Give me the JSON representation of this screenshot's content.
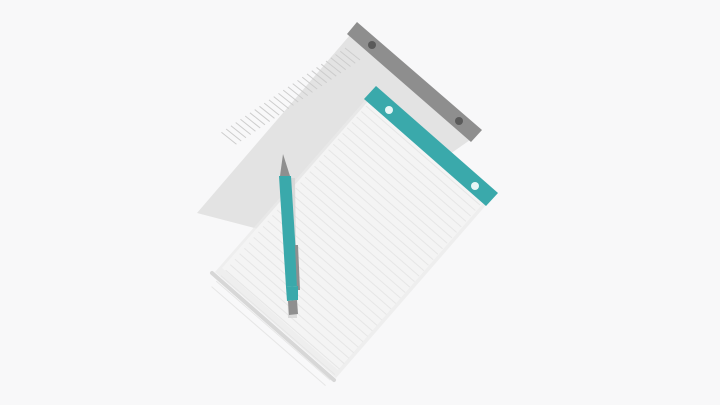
{
  "colors": {
    "background": "#f8f8f9",
    "back_pad_header": "#8e8e8e",
    "back_pad_paper": "#e3e3e3",
    "back_pad_lines": "#cdcdcd",
    "front_pad_header": "#3aa9ab",
    "front_pad_paper": "#f4f4f4",
    "front_pad_lines": "#e6e6e6",
    "pencil_body": "#3aa9ab",
    "pencil_metal": "#8f8f8f",
    "shadow": "#d7d7d7",
    "hole": "#5a5a5a",
    "front_hole": "#e6f6f6"
  },
  "icons": {
    "back_notepad": "notepad-icon",
    "front_notepad": "notepad-icon",
    "pencil": "mechanical-pencil-icon"
  }
}
